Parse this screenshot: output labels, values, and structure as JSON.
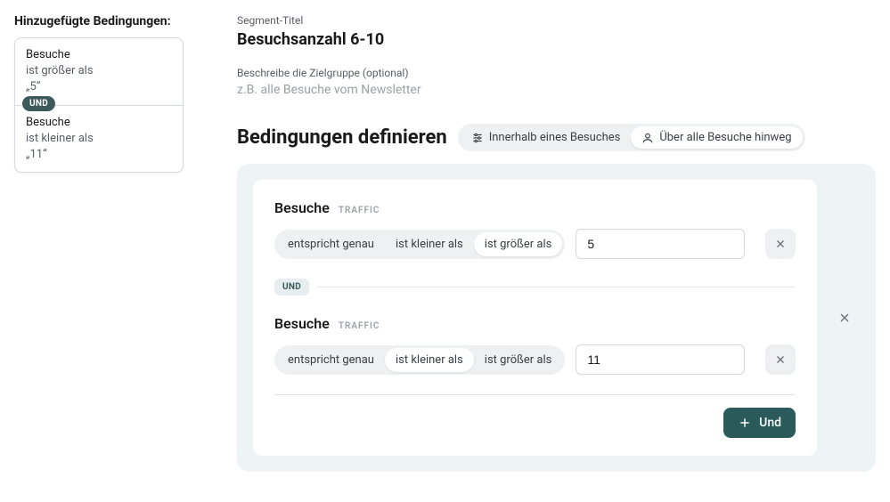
{
  "sidebar": {
    "title": "Hinzugefügte Bedingungen:",
    "conditions": [
      {
        "title": "Besuche",
        "op": "ist größer als",
        "value": "„5“"
      },
      {
        "title": "Besuche",
        "op": "ist kleiner als",
        "value": "„11“"
      }
    ],
    "connector": "UND"
  },
  "main": {
    "segment_label": "Segment-Titel",
    "segment_title": "Besuchsanzahl 6-10",
    "desc_label": "Beschreibe die Zielgruppe (optional)",
    "desc_placeholder": "z.B. alle Besuche vom Newsletter",
    "section_heading": "Bedingungen definieren",
    "scope": {
      "within": "Innerhalb eines Besuches",
      "across": "Über alle Besuche hinweg"
    },
    "ops": {
      "exact": "entspricht genau",
      "lt": "ist kleiner als",
      "gt": "ist größer als"
    },
    "rules": [
      {
        "title": "Besuche",
        "tag": "TRAFFIC",
        "active_op": "gt",
        "value": "5"
      },
      {
        "title": "Besuche",
        "tag": "TRAFFIC",
        "active_op": "lt",
        "value": "11"
      }
    ],
    "connector": "UND",
    "add_label": "Und"
  }
}
